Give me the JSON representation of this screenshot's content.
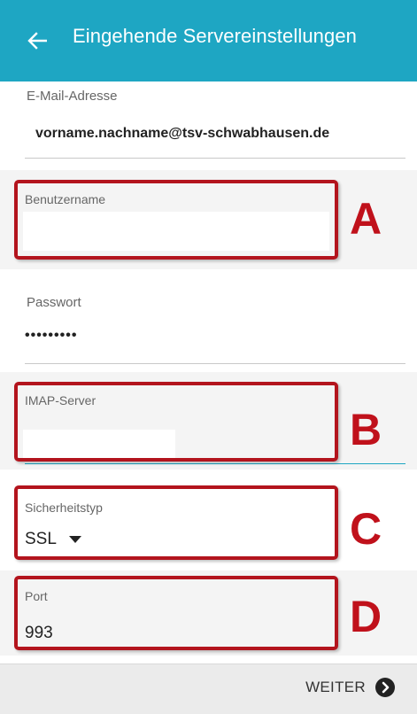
{
  "header": {
    "title": "Eingehende Servereinstellungen",
    "back_icon": "arrow-left-icon",
    "background": "#1ea6c3"
  },
  "fields": {
    "email": {
      "label": "E-Mail-Adresse",
      "value": "vorname.nachname@tsv-schwabhausen.de"
    },
    "username": {
      "label": "Benutzername",
      "value": ""
    },
    "password": {
      "label": "Passwort",
      "value": "•••••••••"
    },
    "imap_server": {
      "label": "IMAP-Server",
      "value": ""
    },
    "security_type": {
      "label": "Sicherheitstyp",
      "value": "SSL",
      "icon": "dropdown-arrow-icon"
    },
    "port": {
      "label": "Port",
      "value": "993"
    }
  },
  "annotations": {
    "a": "A",
    "b": "B",
    "c": "C",
    "d": "D",
    "color": "#c0111b"
  },
  "footer": {
    "next_label": "WEITER",
    "next_icon": "chevron-right-circle-icon"
  }
}
